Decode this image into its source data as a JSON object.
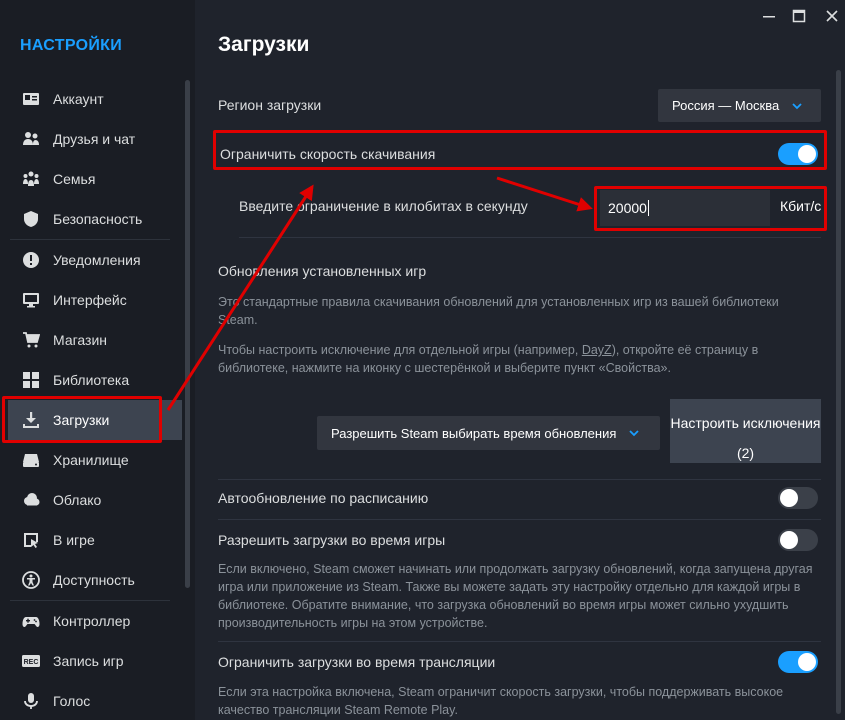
{
  "sidebar": {
    "title": "НАСТРОЙКИ",
    "items": [
      {
        "label": "Аккаунт",
        "icon": "account-card-icon"
      },
      {
        "label": "Друзья и чат",
        "icon": "friends-icon"
      },
      {
        "label": "Семья",
        "icon": "family-icon"
      },
      {
        "label": "Безопасность",
        "icon": "shield-icon"
      },
      {
        "label": "Уведомления",
        "icon": "notification-icon"
      },
      {
        "label": "Интерфейс",
        "icon": "monitor-icon"
      },
      {
        "label": "Магазин",
        "icon": "cart-icon"
      },
      {
        "label": "Библиотека",
        "icon": "library-grid-icon"
      },
      {
        "label": "Загрузки",
        "icon": "download-icon",
        "active": true
      },
      {
        "label": "Хранилище",
        "icon": "storage-drive-icon"
      },
      {
        "label": "Облако",
        "icon": "cloud-icon"
      },
      {
        "label": "В игре",
        "icon": "in-game-icon"
      },
      {
        "label": "Доступность",
        "icon": "accessibility-icon"
      },
      {
        "label": "Контроллер",
        "icon": "gamepad-icon"
      },
      {
        "label": "Запись игр",
        "icon": "rec-icon"
      },
      {
        "label": "Голос",
        "icon": "microphone-icon"
      }
    ]
  },
  "main": {
    "title": "Загрузки",
    "region": {
      "label": "Регион загрузки",
      "value": "Россия — Москва"
    },
    "limit_speed": {
      "label": "Ограничить скорость скачивания",
      "enabled": true
    },
    "kbit_limit": {
      "label": "Введите ограничение в килобитах в секунду",
      "value": "20000",
      "unit": "Кбит/с"
    },
    "updates": {
      "heading": "Обновления установленных игр",
      "desc1": "Это стандартные правила скачивания обновлений для установленных игр из вашей библиотеки Steam.",
      "desc2_pre": "Чтобы настроить исключение для отдельной игры (например, ",
      "desc2_link": "DayZ",
      "desc2_post": "), откройте её страницу в библиотеке, нажмите на иконку с шестерёнкой и выберите пункт «Свойства».",
      "select_value": "Разрешить Steam выбирать время обновления",
      "exceptions_label": "Настроить исключения",
      "exceptions_count": "(2)"
    },
    "auto_update": {
      "label": "Автообновление по расписанию",
      "enabled": false
    },
    "allow_during_game": {
      "label": "Разрешить загрузки во время игры",
      "enabled": false,
      "desc": "Если включено, Steam сможет начинать или продолжать загрузку обновлений, когда запущена другая игра или приложение из Steam. Также вы можете задать эту настройку отдельно для каждой игры в библиотеке. Обратите внимание, что загрузка обновлений во время игры может сильно ухудшить производительность игры на этом устройстве."
    },
    "limit_broadcast": {
      "label": "Ограничить загрузки во время трансляции",
      "enabled": true,
      "desc": "Если эта настройка включена, Steam ограничит скорость загрузки, чтобы поддерживать высокое качество трансляции Steam Remote Play."
    }
  },
  "colors": {
    "accent": "#1a9fff",
    "highlight": "#e00000",
    "background": "#1f232c"
  }
}
